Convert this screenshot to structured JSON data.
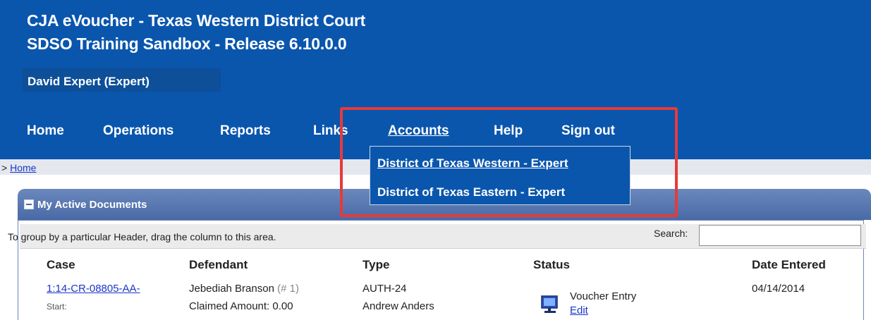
{
  "header": {
    "title_line1": "CJA eVoucher - Texas Western District Court",
    "title_line2": "SDSO Training Sandbox - Release 6.10.0.0",
    "user": "David Expert (Expert)"
  },
  "nav": {
    "items": [
      "Home",
      "Operations",
      "Reports",
      "Links",
      "Accounts",
      "Help",
      "Sign out"
    ],
    "accounts_menu": [
      "District of Texas Western -  Expert",
      "District of Texas Eastern - Expert"
    ]
  },
  "breadcrumb": {
    "prefix": ">",
    "home": "Home"
  },
  "panel": {
    "title": "My Active Documents",
    "group_hint": "To group by a particular Header, drag the column to this area.",
    "search_label": "Search:",
    "search_value": "",
    "columns": [
      "Case",
      "Defendant",
      "Type",
      "Status",
      "Date Entered"
    ],
    "rows": [
      {
        "case": "1:14-CR-08805-AA-",
        "case_sub": "Start:",
        "defendant": "Jebediah Branson",
        "defendant_num": "(# 1)",
        "claimed": "Claimed Amount: 0.00",
        "type": "AUTH-24",
        "type_sub": "Andrew Anders",
        "status": "Voucher Entry",
        "status_action": "Edit",
        "date": "04/14/2014"
      }
    ]
  },
  "colors": {
    "header_bg": "#0a56ad",
    "highlight": "#e63a3a",
    "link": "#1a35c8",
    "panel_head": "#4a6aa6"
  },
  "icons": {
    "collapse": "minus-box-icon",
    "status": "computer-monitor-icon"
  }
}
